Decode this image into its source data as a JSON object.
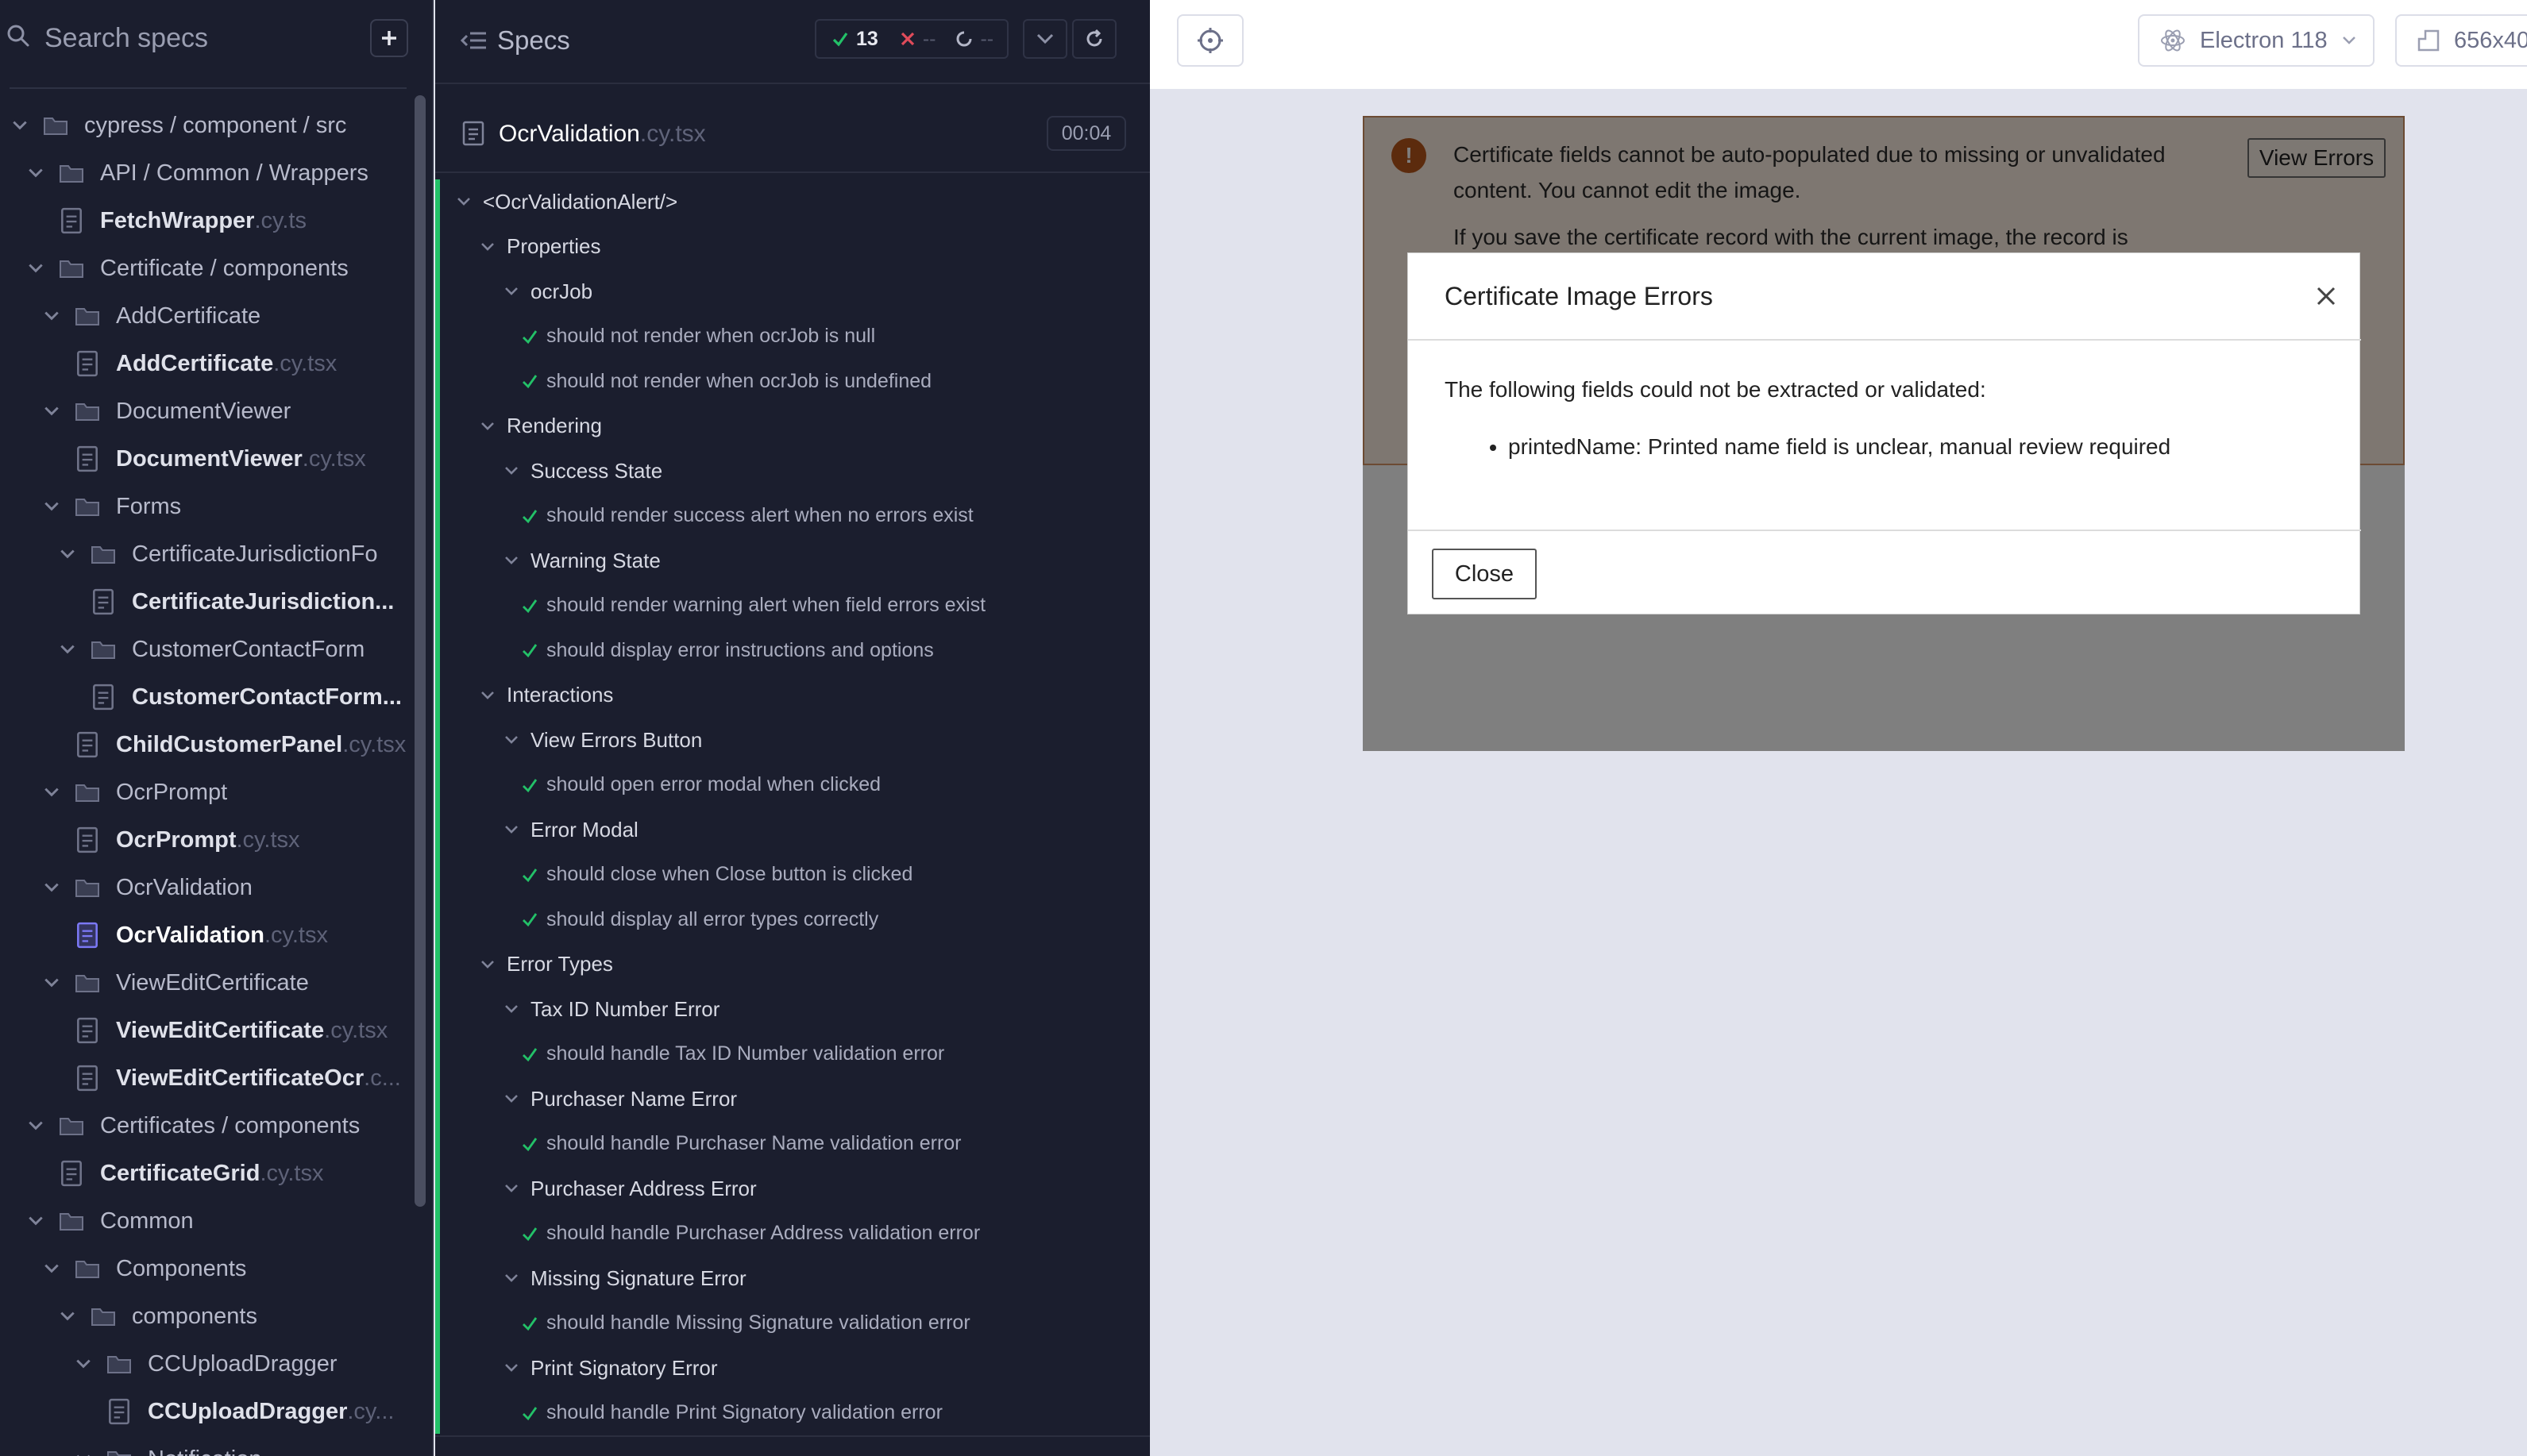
{
  "sidebar": {
    "search_placeholder": "Search specs",
    "tree": [
      {
        "kind": "folder",
        "depth": 0,
        "label": "cypress / component / src"
      },
      {
        "kind": "folder",
        "depth": 1,
        "label": "API / Common / Wrappers"
      },
      {
        "kind": "file",
        "depth": 2,
        "name": "FetchWrapper",
        "ext": ".cy.ts"
      },
      {
        "kind": "folder",
        "depth": 1,
        "label": "Certificate / components"
      },
      {
        "kind": "folder",
        "depth": 2,
        "label": "AddCertificate"
      },
      {
        "kind": "file",
        "depth": 3,
        "name": "AddCertificate",
        "ext": ".cy.tsx"
      },
      {
        "kind": "folder",
        "depth": 2,
        "label": "DocumentViewer"
      },
      {
        "kind": "file",
        "depth": 3,
        "name": "DocumentViewer",
        "ext": ".cy.tsx"
      },
      {
        "kind": "folder",
        "depth": 2,
        "label": "Forms"
      },
      {
        "kind": "folder",
        "depth": 3,
        "label": "CertificateJurisdictionFo"
      },
      {
        "kind": "file",
        "depth": 4,
        "name": "CertificateJurisdiction...",
        "ext": ""
      },
      {
        "kind": "folder",
        "depth": 3,
        "label": "CustomerContactForm"
      },
      {
        "kind": "file",
        "depth": 4,
        "name": "CustomerContactForm...",
        "ext": ""
      },
      {
        "kind": "file",
        "depth": 3,
        "name": "ChildCustomerPanel",
        "ext": ".cy.tsx"
      },
      {
        "kind": "folder",
        "depth": 2,
        "label": "OcrPrompt"
      },
      {
        "kind": "file",
        "depth": 3,
        "name": "OcrPrompt",
        "ext": ".cy.tsx"
      },
      {
        "kind": "folder",
        "depth": 2,
        "label": "OcrValidation"
      },
      {
        "kind": "file",
        "depth": 3,
        "name": "OcrValidation",
        "ext": ".cy.tsx",
        "active": true
      },
      {
        "kind": "folder",
        "depth": 2,
        "label": "ViewEditCertificate"
      },
      {
        "kind": "file",
        "depth": 3,
        "name": "ViewEditCertificate",
        "ext": ".cy.tsx"
      },
      {
        "kind": "file",
        "depth": 3,
        "name": "ViewEditCertificateOcr",
        "ext": ".c..."
      },
      {
        "kind": "folder",
        "depth": 1,
        "label": "Certificates / components"
      },
      {
        "kind": "file",
        "depth": 2,
        "name": "CertificateGrid",
        "ext": ".cy.tsx"
      },
      {
        "kind": "folder",
        "depth": 1,
        "label": "Common"
      },
      {
        "kind": "folder",
        "depth": 2,
        "label": "Components"
      },
      {
        "kind": "folder",
        "depth": 3,
        "label": "components"
      },
      {
        "kind": "folder",
        "depth": 4,
        "label": "CCUploadDragger"
      },
      {
        "kind": "file",
        "depth": 5,
        "name": "CCUploadDragger",
        "ext": ".cy..."
      },
      {
        "kind": "folder",
        "depth": 4,
        "label": "Notification"
      }
    ]
  },
  "reporter": {
    "header_title": "Specs",
    "passed": "13",
    "failed": "--",
    "pending": "--",
    "spec_name": "OcrValidation",
    "spec_ext": ".cy.tsx",
    "duration": "00:04",
    "rows": [
      {
        "kind": "suite",
        "depth": 0,
        "label": "<OcrValidationAlert/>"
      },
      {
        "kind": "suite",
        "depth": 1,
        "label": "Properties"
      },
      {
        "kind": "suite",
        "depth": 2,
        "label": "ocrJob"
      },
      {
        "kind": "test",
        "depth": 3,
        "label": "should not render when ocrJob is null"
      },
      {
        "kind": "test",
        "depth": 3,
        "label": "should not render when ocrJob is undefined"
      },
      {
        "kind": "suite",
        "depth": 1,
        "label": "Rendering"
      },
      {
        "kind": "suite",
        "depth": 2,
        "label": "Success State"
      },
      {
        "kind": "test",
        "depth": 3,
        "label": "should render success alert when no errors exist"
      },
      {
        "kind": "suite",
        "depth": 2,
        "label": "Warning State"
      },
      {
        "kind": "test",
        "depth": 3,
        "label": "should render warning alert when field errors exist"
      },
      {
        "kind": "test",
        "depth": 3,
        "label": "should display error instructions and options"
      },
      {
        "kind": "suite",
        "depth": 1,
        "label": "Interactions"
      },
      {
        "kind": "suite",
        "depth": 2,
        "label": "View Errors Button"
      },
      {
        "kind": "test",
        "depth": 3,
        "label": "should open error modal when clicked"
      },
      {
        "kind": "suite",
        "depth": 2,
        "label": "Error Modal"
      },
      {
        "kind": "test",
        "depth": 3,
        "label": "should close when Close button is clicked"
      },
      {
        "kind": "test",
        "depth": 3,
        "label": "should display all error types correctly"
      },
      {
        "kind": "suite",
        "depth": 1,
        "label": "Error Types"
      },
      {
        "kind": "suite",
        "depth": 2,
        "label": "Tax ID Number Error"
      },
      {
        "kind": "test",
        "depth": 3,
        "label": "should handle Tax ID Number validation error"
      },
      {
        "kind": "suite",
        "depth": 2,
        "label": "Purchaser Name Error"
      },
      {
        "kind": "test",
        "depth": 3,
        "label": "should handle Purchaser Name validation error"
      },
      {
        "kind": "suite",
        "depth": 2,
        "label": "Purchaser Address Error"
      },
      {
        "kind": "test",
        "depth": 3,
        "label": "should handle Purchaser Address validation error"
      },
      {
        "kind": "suite",
        "depth": 2,
        "label": "Missing Signature Error"
      },
      {
        "kind": "test",
        "depth": 3,
        "label": "should handle Missing Signature validation error"
      },
      {
        "kind": "suite",
        "depth": 2,
        "label": "Print Signatory Error"
      },
      {
        "kind": "test",
        "depth": 3,
        "label": "should handle Print Signatory validation error"
      }
    ]
  },
  "preview": {
    "browser": "Electron 118",
    "viewport": "656x40",
    "alert": {
      "line1": "Certificate fields cannot be auto-populated due to missing or unvalidated content. You cannot edit the image.",
      "line2": "If you save the certificate record with the current image, the record is",
      "button": "View Errors"
    },
    "modal": {
      "title": "Certificate Image Errors",
      "intro": "The following fields could not be extracted or validated:",
      "errors": [
        "printedName: Printed name field is unclear, manual review required"
      ],
      "close_label": "Close"
    }
  },
  "colors": {
    "panel_bg": "#1b1e2e",
    "pass_green": "#23c168",
    "fail_red": "#e04b5a",
    "active_file": "#7b78f5",
    "alert_bg": "#fcefe3",
    "alert_icon": "#b8561b"
  }
}
